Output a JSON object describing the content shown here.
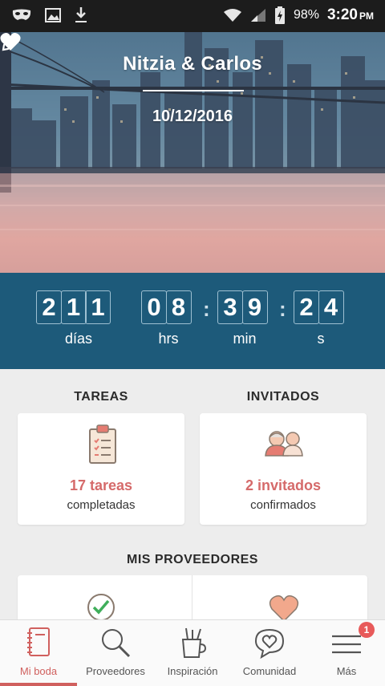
{
  "status_bar": {
    "battery": "98%",
    "time": "3:20",
    "ampm": "PM",
    "icons": [
      "mask-icon",
      "image-icon",
      "download-icon",
      "wifi-icon",
      "signal-icon",
      "battery-icon"
    ]
  },
  "hero": {
    "couple": "Nitzia & Carlos",
    "date": "10/12/2016",
    "edit_icon": "pencil-icon"
  },
  "countdown": {
    "days": [
      "2",
      "1",
      "1"
    ],
    "hours": [
      "0",
      "8"
    ],
    "minutes": [
      "3",
      "9"
    ],
    "seconds": [
      "2",
      "4"
    ],
    "labels": {
      "days": "días",
      "hours": "hrs",
      "minutes": "min",
      "seconds": "s"
    }
  },
  "tasks": {
    "title": "TAREAS",
    "count": "17 tareas",
    "status": "completadas",
    "icon": "clipboard-icon"
  },
  "guests": {
    "title": "INVITADOS",
    "count": "2 invitados",
    "status": "confirmados",
    "icon": "couple-icon"
  },
  "providers": {
    "title": "MIS PROVEEDORES",
    "icons": [
      "check-circle-icon",
      "heart-icon"
    ]
  },
  "nav": {
    "items": [
      {
        "label": "Mi boda",
        "icon": "notebook-icon",
        "active": true
      },
      {
        "label": "Proveedores",
        "icon": "search-icon"
      },
      {
        "label": "Inspiración",
        "icon": "brushes-icon"
      },
      {
        "label": "Comunidad",
        "icon": "heart-chat-icon"
      },
      {
        "label": "Más",
        "icon": "menu-icon"
      }
    ],
    "badge": "1"
  },
  "colors": {
    "accent": "#d0605e",
    "countdown_bg": "#1d5a7a",
    "task_text": "#d56a6a"
  }
}
